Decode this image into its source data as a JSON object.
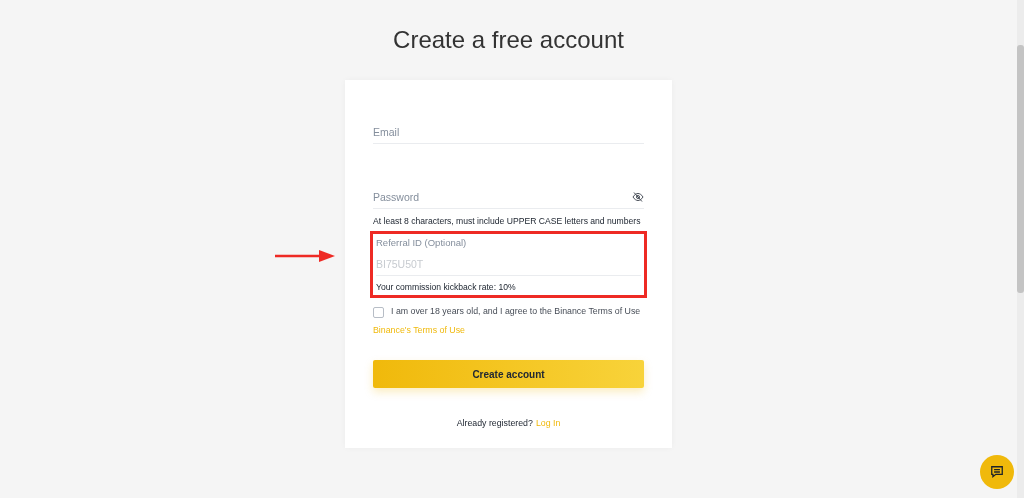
{
  "title": "Create a free account",
  "email": {
    "placeholder": "Email"
  },
  "password": {
    "placeholder": "Password",
    "visible": false,
    "hint": "At least 8 characters, must include UPPER CASE letters and numbers"
  },
  "referral": {
    "label": "Referral ID (Optional)",
    "placeholder": "BI75U50T",
    "note": "Your commission kickback rate: 10%",
    "highlighted": true
  },
  "terms": {
    "checked": false,
    "text": "I am over 18 years old, and I agree to the Binance Terms of Use",
    "link": "Binance's Terms of Use"
  },
  "submit": "Create account",
  "login": {
    "text": "Already registered?",
    "link": "Log In"
  }
}
